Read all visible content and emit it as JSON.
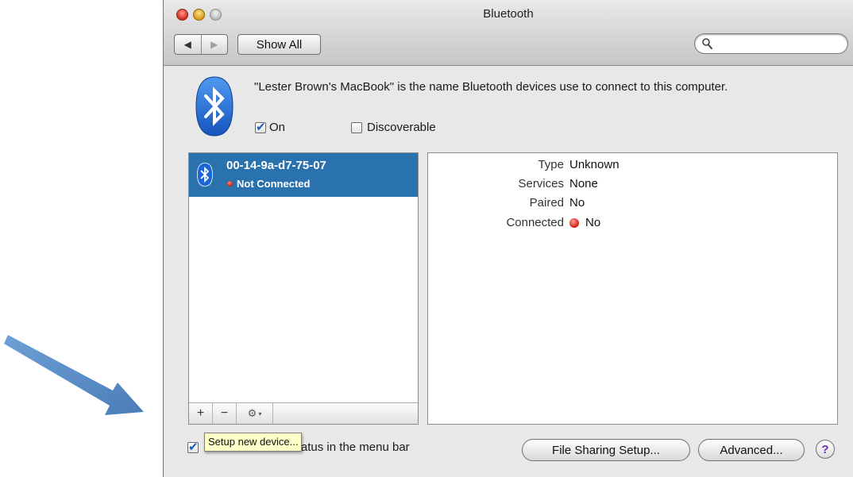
{
  "window": {
    "title": "Bluetooth"
  },
  "toolbar": {
    "back_glyph": "◀",
    "forward_glyph": "▶",
    "show_all_label": "Show All",
    "search_value": ""
  },
  "header": {
    "description": "\"Lester Brown's MacBook\" is the name Bluetooth devices use to connect to this computer.",
    "on_label": "On",
    "on_checked": true,
    "discoverable_label": "Discoverable",
    "discoverable_checked": false
  },
  "devices": {
    "items": [
      {
        "name": "00-14-9a-d7-75-07",
        "status": "Not Connected",
        "selected": true
      }
    ],
    "add_glyph": "+",
    "remove_glyph": "−",
    "gear_glyph": "⚙",
    "gear_caret": "▾"
  },
  "details": {
    "rows": [
      {
        "label": "Type",
        "value": "Unknown"
      },
      {
        "label": "Services",
        "value": "None"
      },
      {
        "label": "Paired",
        "value": "No"
      },
      {
        "label": "Connected",
        "value": "No"
      }
    ]
  },
  "footer": {
    "show_status_label": "Show Bluetooth status in the menu bar",
    "show_status_checked": true,
    "tooltip_text": "Setup new device...",
    "file_sharing_label": "File Sharing Setup...",
    "advanced_label": "Advanced...",
    "help_glyph": "?"
  },
  "colors": {
    "selection": "#2a72ad",
    "bluetooth_blue": "#1a66d6",
    "arrow": "#5a8cc6",
    "status_red": "#d4190c"
  }
}
